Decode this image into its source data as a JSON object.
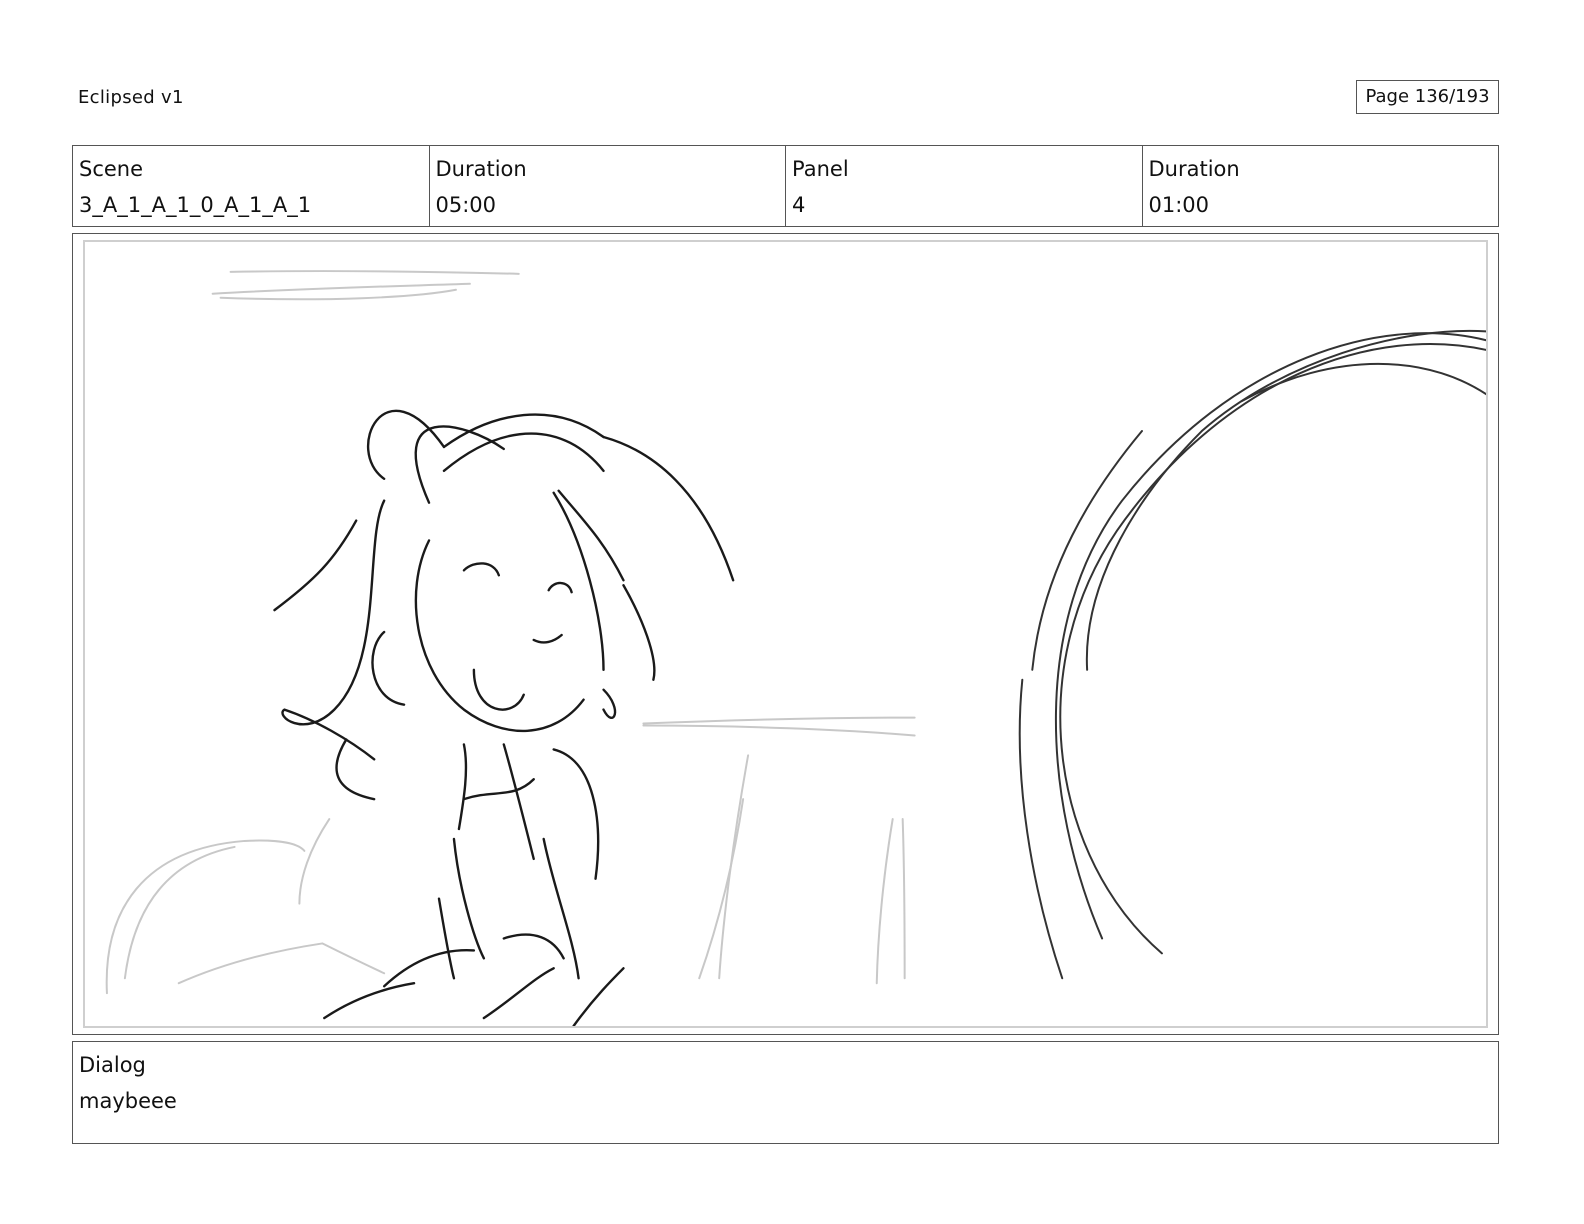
{
  "header": {
    "project_title": "Eclipsed v1",
    "page_counter": "Page 136/193"
  },
  "info_table": [
    {
      "label": "Scene",
      "value": "3_A_1_A_1_0_A_1_A_1"
    },
    {
      "label": "Duration",
      "value": "05:00"
    },
    {
      "label": "Panel",
      "value": "4"
    },
    {
      "label": "Duration",
      "value": "01:00"
    }
  ],
  "panel": {
    "drawing": "rough-pencil-sketch"
  },
  "dialog": {
    "label": "Dialog",
    "text": "maybeee"
  },
  "colors": {
    "border": "#555555",
    "panel_inner_border": "#cfcfcf",
    "sketch_dark": "#1a1a1a",
    "sketch_light": "#c8c8c8"
  }
}
